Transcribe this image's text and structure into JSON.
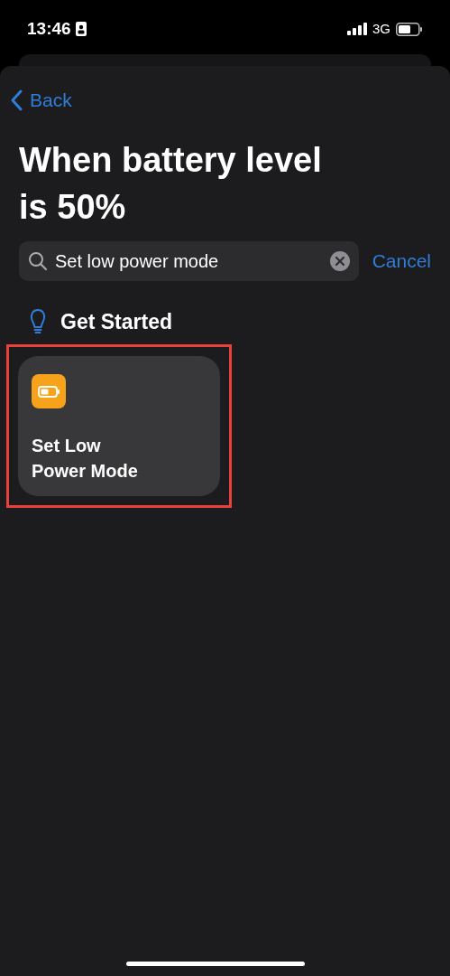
{
  "status_bar": {
    "time": "13:46",
    "network": "3G"
  },
  "nav": {
    "back": "Back"
  },
  "title": "When battery level is 50%",
  "search": {
    "value": "Set low power mode",
    "cancel": "Cancel"
  },
  "section": {
    "title": "Get Started"
  },
  "actions": [
    {
      "label": "Set Low Power Mode",
      "highlighted": true
    }
  ]
}
